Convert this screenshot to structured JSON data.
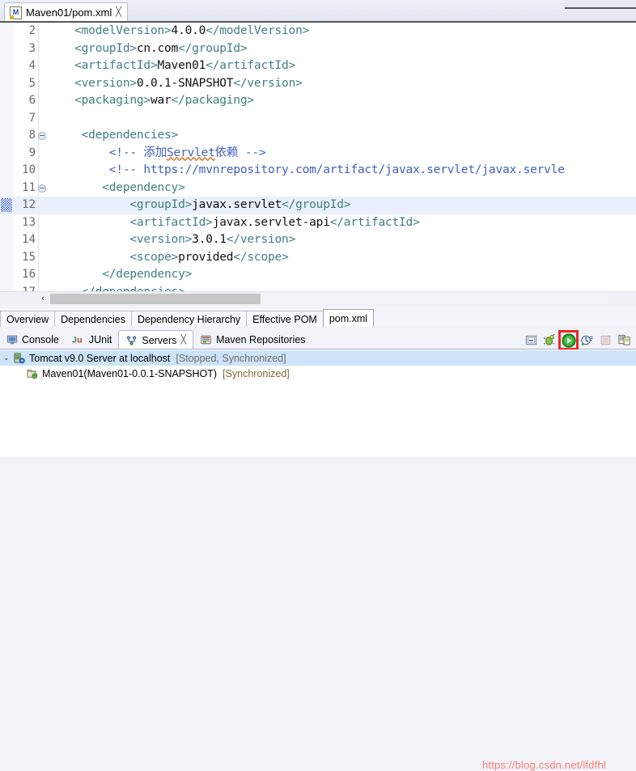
{
  "editor": {
    "tab": {
      "title": "Maven01/pom.xml",
      "icon": "maven-file-icon",
      "close": "╳",
      "badge": "M"
    },
    "code_lines": [
      {
        "num": "2",
        "fold": false,
        "marker": false,
        "highlight": false,
        "segments": [
          {
            "t": "    ",
            "c": "val"
          },
          {
            "t": "<modelVersion>",
            "c": "tg"
          },
          {
            "t": "4.0.0",
            "c": "val"
          },
          {
            "t": "</modelVersion>",
            "c": "tg"
          }
        ]
      },
      {
        "num": "3",
        "fold": false,
        "marker": false,
        "highlight": false,
        "segments": [
          {
            "t": "    ",
            "c": "val"
          },
          {
            "t": "<groupId>",
            "c": "tg"
          },
          {
            "t": "cn.com",
            "c": "val"
          },
          {
            "t": "</groupId>",
            "c": "tg"
          }
        ]
      },
      {
        "num": "4",
        "fold": false,
        "marker": false,
        "highlight": false,
        "segments": [
          {
            "t": "    ",
            "c": "val"
          },
          {
            "t": "<artifactId>",
            "c": "tg"
          },
          {
            "t": "Maven01",
            "c": "val"
          },
          {
            "t": "</artifactId>",
            "c": "tg"
          }
        ]
      },
      {
        "num": "5",
        "fold": false,
        "marker": false,
        "highlight": false,
        "segments": [
          {
            "t": "    ",
            "c": "val"
          },
          {
            "t": "<version>",
            "c": "tg"
          },
          {
            "t": "0.0.1-SNAPSHOT",
            "c": "val"
          },
          {
            "t": "</version>",
            "c": "tg"
          }
        ]
      },
      {
        "num": "6",
        "fold": false,
        "marker": false,
        "highlight": false,
        "segments": [
          {
            "t": "    ",
            "c": "val"
          },
          {
            "t": "<packaging>",
            "c": "tg"
          },
          {
            "t": "war",
            "c": "val"
          },
          {
            "t": "</packaging>",
            "c": "tg"
          }
        ]
      },
      {
        "num": "7",
        "fold": false,
        "marker": false,
        "highlight": false,
        "segments": []
      },
      {
        "num": "8",
        "fold": true,
        "marker": false,
        "highlight": false,
        "segments": [
          {
            "t": "     ",
            "c": "val"
          },
          {
            "t": "<dependencies>",
            "c": "tg"
          }
        ]
      },
      {
        "num": "9",
        "fold": false,
        "marker": false,
        "highlight": false,
        "segments": [
          {
            "t": "         ",
            "c": "val"
          },
          {
            "t": "<!-- 添加",
            "c": "cm"
          },
          {
            "t": "Servlet",
            "c": "cm squig"
          },
          {
            "t": "依赖 -->",
            "c": "cm"
          }
        ]
      },
      {
        "num": "10",
        "fold": false,
        "marker": false,
        "highlight": false,
        "segments": [
          {
            "t": "         ",
            "c": "val"
          },
          {
            "t": "<!-- https://mvnrepository.com/artifact/javax.servlet/javax.servle",
            "c": "cm"
          }
        ]
      },
      {
        "num": "11",
        "fold": true,
        "marker": false,
        "highlight": false,
        "segments": [
          {
            "t": "        ",
            "c": "val"
          },
          {
            "t": "<dependency>",
            "c": "tg"
          }
        ]
      },
      {
        "num": "12",
        "fold": false,
        "marker": true,
        "highlight": true,
        "segments": [
          {
            "t": "            ",
            "c": "val"
          },
          {
            "t": "<groupId>",
            "c": "tg"
          },
          {
            "t": "javax.servlet",
            "c": "val"
          },
          {
            "t": "</groupId>",
            "c": "tg"
          }
        ]
      },
      {
        "num": "13",
        "fold": false,
        "marker": false,
        "highlight": false,
        "segments": [
          {
            "t": "            ",
            "c": "val"
          },
          {
            "t": "<artifactId>",
            "c": "tg"
          },
          {
            "t": "javax.servlet-api",
            "c": "val"
          },
          {
            "t": "</artifactId>",
            "c": "tg"
          }
        ]
      },
      {
        "num": "14",
        "fold": false,
        "marker": false,
        "highlight": false,
        "segments": [
          {
            "t": "            ",
            "c": "val"
          },
          {
            "t": "<version>",
            "c": "tg"
          },
          {
            "t": "3.0.1",
            "c": "val"
          },
          {
            "t": "</version>",
            "c": "tg"
          }
        ]
      },
      {
        "num": "15",
        "fold": false,
        "marker": false,
        "highlight": false,
        "segments": [
          {
            "t": "            ",
            "c": "val"
          },
          {
            "t": "<scope>",
            "c": "tg"
          },
          {
            "t": "provided",
            "c": "val"
          },
          {
            "t": "</scope>",
            "c": "tg"
          }
        ]
      },
      {
        "num": "16",
        "fold": false,
        "marker": false,
        "highlight": false,
        "segments": [
          {
            "t": "        ",
            "c": "val"
          },
          {
            "t": "</dependency>",
            "c": "tg"
          }
        ]
      },
      {
        "num": "17",
        "fold": false,
        "marker": false,
        "highlight": false,
        "segments": [
          {
            "t": "     ",
            "c": "val"
          },
          {
            "t": "</dependencies>",
            "c": "tg"
          }
        ]
      }
    ],
    "hscroll": {
      "left_arrow": "‹"
    },
    "page_tabs": [
      {
        "label": "Overview",
        "selected": false
      },
      {
        "label": "Dependencies",
        "selected": false
      },
      {
        "label": "Dependency Hierarchy",
        "selected": false
      },
      {
        "label": "Effective POM",
        "selected": false
      },
      {
        "label": "pom.xml",
        "selected": true
      }
    ]
  },
  "views": {
    "tabs": [
      {
        "label": "Console",
        "icon": "console-icon",
        "selected": false,
        "closable": false
      },
      {
        "label": "JUnit",
        "icon": "junit-icon",
        "selected": false,
        "closable": false
      },
      {
        "label": "Servers",
        "icon": "servers-icon",
        "selected": true,
        "closable": true
      },
      {
        "label": "Maven Repositories",
        "icon": "maven-repo-icon",
        "selected": false,
        "closable": false
      }
    ],
    "close_glyph": "╳",
    "toolbar": [
      {
        "name": "minimize-icon",
        "label": "Minimize",
        "highlighted": false,
        "enabled": true
      },
      {
        "name": "debug-icon",
        "label": "Debug",
        "highlighted": false,
        "enabled": true
      },
      {
        "name": "start-icon",
        "label": "Start",
        "highlighted": true,
        "enabled": true
      },
      {
        "name": "profile-icon",
        "label": "Profile",
        "highlighted": false,
        "enabled": true
      },
      {
        "name": "stop-icon",
        "label": "Stop",
        "highlighted": false,
        "enabled": false
      },
      {
        "name": "publish-icon",
        "label": "Publish",
        "highlighted": false,
        "enabled": true
      }
    ],
    "highlight_color": "#f02424",
    "tree": {
      "server": {
        "twisty": "⌄",
        "icon": "server-icon",
        "label": "Tomcat v9.0 Server at localhost",
        "status": "[Stopped, Synchronized]",
        "selected": true
      },
      "module": {
        "icon": "module-icon",
        "label": "Maven01(Maven01-0.0.1-SNAPSHOT)",
        "status": "[Synchronized]",
        "selected": false
      }
    }
  },
  "watermark": {
    "text": "https://blog.csdn.net/lfdfhl",
    "color": "#fb7a72"
  }
}
